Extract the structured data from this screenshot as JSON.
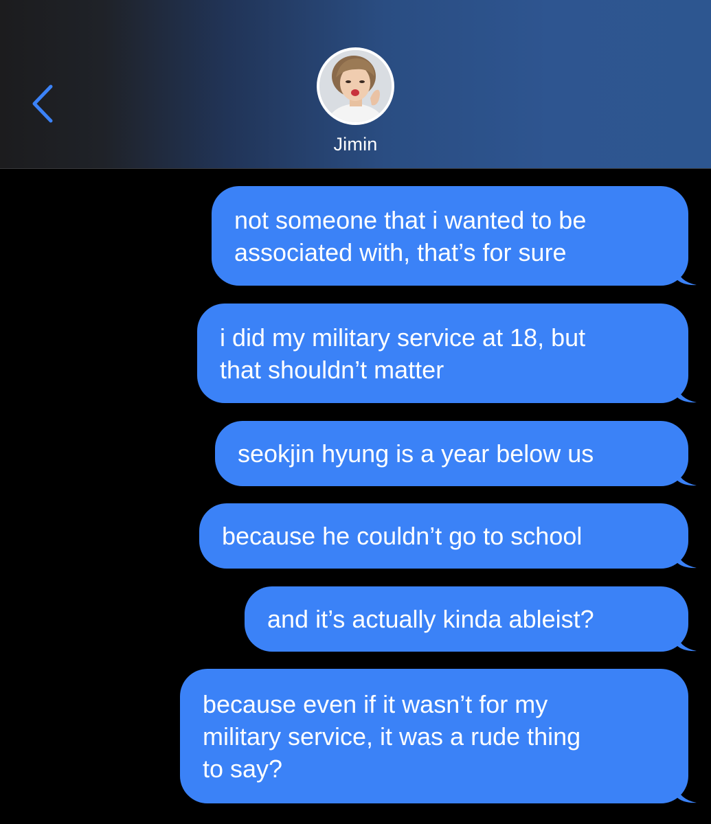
{
  "header": {
    "back_icon": "chevron-left-icon",
    "contact_name": "Jimin",
    "avatar_icon": "contact-avatar"
  },
  "colors": {
    "bubble": "#3b82f7",
    "accent": "#3b82f7",
    "background": "#000000"
  },
  "messages": [
    {
      "text": "not someone that i wanted to be\nassociated with, that’s for sure",
      "sender": "me"
    },
    {
      "text": "i did my military service at 18, but\nthat shouldn’t matter",
      "sender": "me"
    },
    {
      "text": "seokjin hyung is a year below us",
      "sender": "me"
    },
    {
      "text": "because he couldn’t go to school",
      "sender": "me"
    },
    {
      "text": "and it’s actually kinda ableist?",
      "sender": "me"
    },
    {
      "text": "because even if it wasn’t for my\nmilitary service, it was a rude thing\nto say?",
      "sender": "me"
    }
  ]
}
